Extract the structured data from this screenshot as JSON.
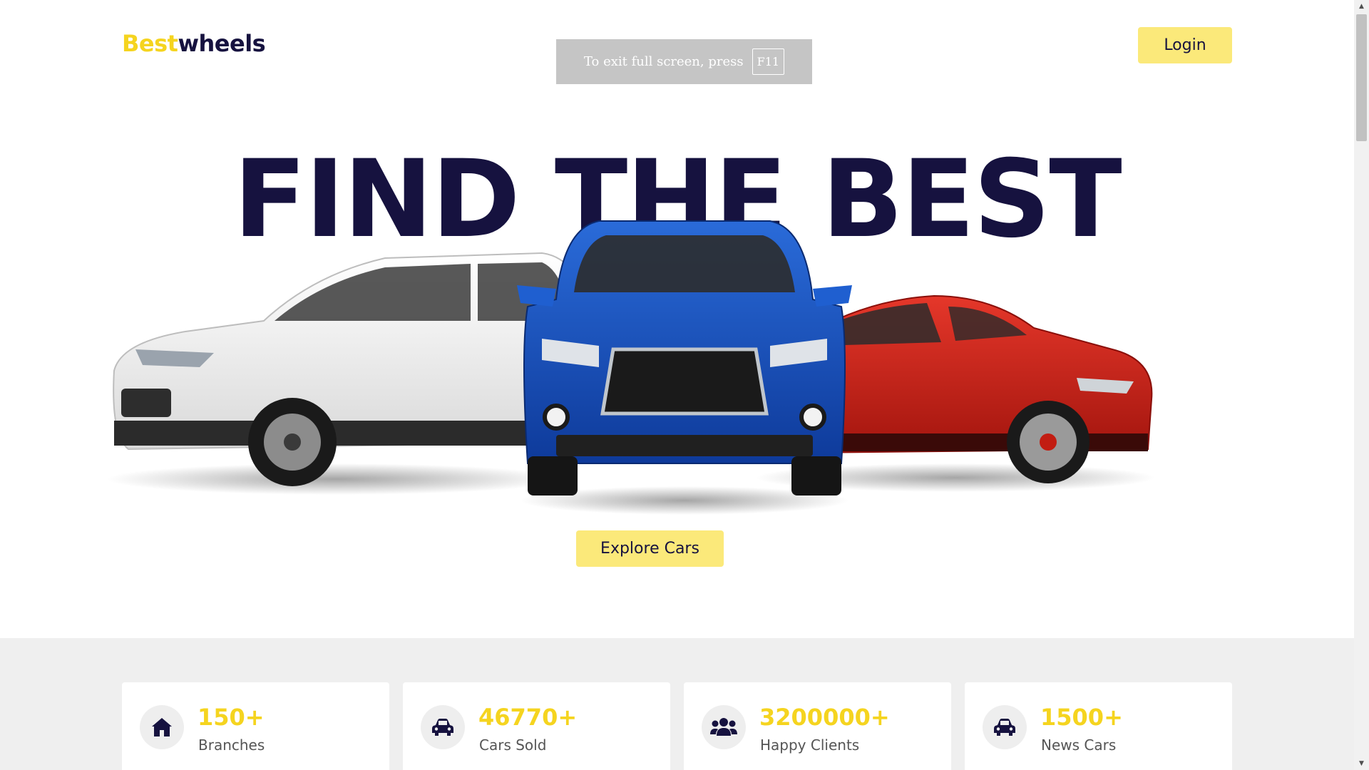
{
  "header": {
    "logo_part1": "Best",
    "logo_part2": "wheels",
    "login_label": "Login"
  },
  "fullscreen_toast": {
    "message": "To exit full screen, press",
    "key": "F11"
  },
  "hero": {
    "title": "FIND THE BEST",
    "explore_label": "Explore Cars",
    "image": "three-cars-white-blue-red"
  },
  "stats": [
    {
      "icon": "home-icon",
      "value": "150+",
      "label": "Branches"
    },
    {
      "icon": "car-icon",
      "value": "46770+",
      "label": "Cars Sold"
    },
    {
      "icon": "users-icon",
      "value": "3200000+",
      "label": "Happy Clients"
    },
    {
      "icon": "car-icon",
      "value": "1500+",
      "label": "News Cars"
    }
  ],
  "colors": {
    "accent_yellow": "#f5d41f",
    "button_yellow": "#fbe97a",
    "navy": "#16123f",
    "band_gray": "#efefef"
  }
}
